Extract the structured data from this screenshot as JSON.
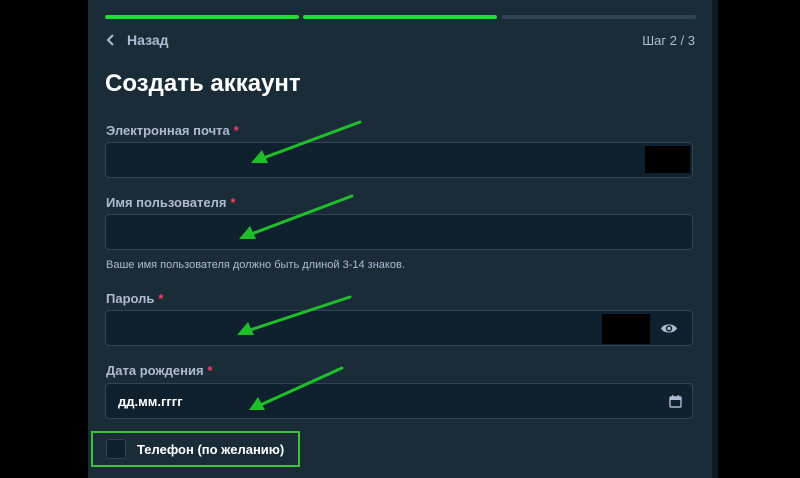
{
  "colors": {
    "progress_active": "#1fdd33",
    "progress_inactive": "#2f4553",
    "annotation_arrow": "#1fbf2a",
    "required_mark": "#ed4163",
    "highlight_border": "#3dc23d"
  },
  "progress": {
    "steps_total": 3,
    "steps_completed": 2
  },
  "header": {
    "back_label": "Назад",
    "step_label": "Шаг 2 / 3"
  },
  "title": "Создать аккаунт",
  "form": {
    "required_mark": "*",
    "email": {
      "label": "Электронная почта",
      "value": ""
    },
    "username": {
      "label": "Имя пользователя",
      "value": "",
      "hint": "Ваше имя пользователя должно быть длиной 3-14 знаков."
    },
    "password": {
      "label": "Пароль",
      "value": "",
      "toggle_icon": "eye-icon"
    },
    "birthdate": {
      "label": "Дата рождения",
      "placeholder": "дд.мм.гггг",
      "icon": "calendar-icon"
    },
    "phone": {
      "label": "Телефон (по желанию)",
      "checked": false
    }
  }
}
